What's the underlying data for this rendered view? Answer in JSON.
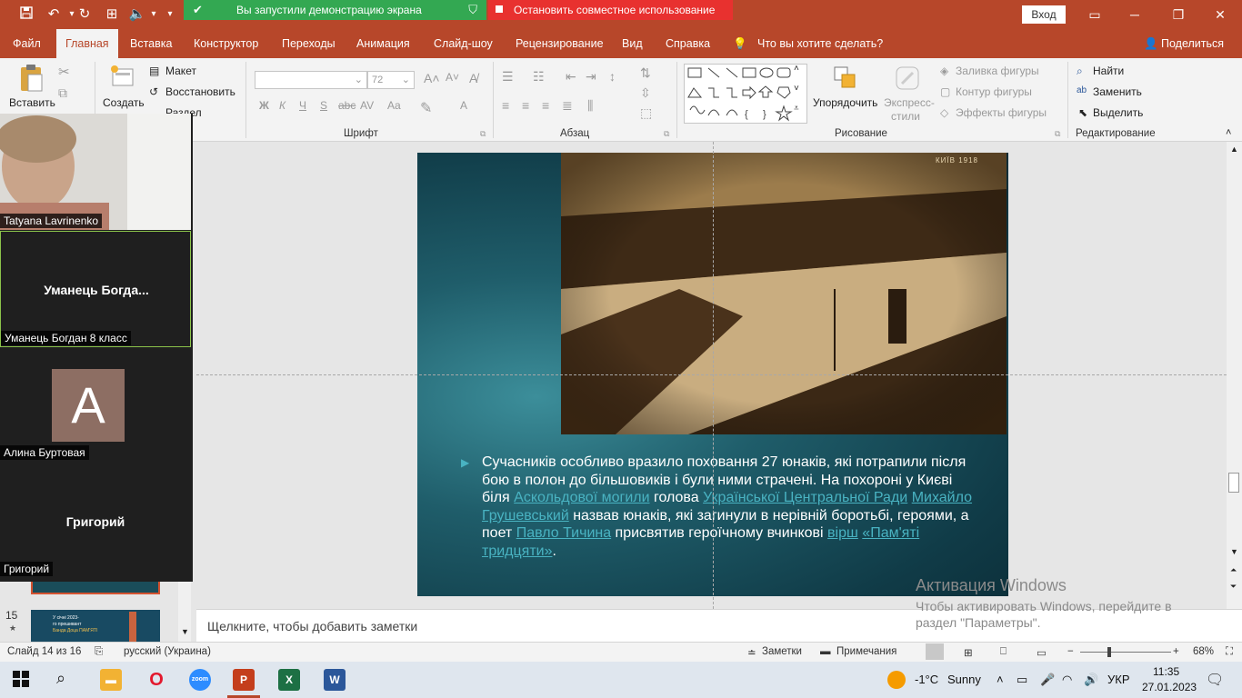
{
  "quick_access": {
    "save": "save-icon",
    "undo": "undo-icon",
    "redo": "redo-icon",
    "from_beginning": "start-slideshow-icon",
    "audio": "speaker-icon",
    "customize": "more-icon"
  },
  "zoom_share": {
    "banner_text": "Вы запустили демонстрацию экрана",
    "stop_text": "Остановить совместное использование"
  },
  "window": {
    "signin": "Вход",
    "ribbon_display": "ribbon-display-icon",
    "minimize": "minimize-icon",
    "restore": "restore-icon",
    "close": "close-icon"
  },
  "tabs": [
    "Файл",
    "Главная",
    "Вставка",
    "Конструктор",
    "Переходы",
    "Анимация",
    "Слайд-шоу",
    "Рецензирование",
    "Вид",
    "Справка"
  ],
  "active_tab": "Главная",
  "tell_me": "Что вы хотите сделать?",
  "share": "Поделиться",
  "ribbon": {
    "paste": "Вставить",
    "create": "Создать",
    "layout": "Макет",
    "reset": "Восстановить",
    "section": "Раздел",
    "font_size": "72",
    "font_group": "Шрифт",
    "bold": "Ж",
    "italic": "К",
    "underline": "Ч",
    "strike": "S",
    "shadow": "abc",
    "spacing": "AV",
    "case": "Aa",
    "font_color": "A",
    "paragraph_group": "Абзац",
    "arrange": "Упорядочить",
    "quick_styles": "Экспресс-",
    "quick_styles_2": "стили",
    "fill": "Заливка фигуры",
    "outline": "Контур фигуры",
    "effects": "Эффекты фигуры",
    "drawing_group": "Рисование",
    "find": "Найти",
    "replace": "Заменить",
    "select": "Выделить",
    "editing_group": "Редактирование"
  },
  "participants": [
    {
      "name": "Tatyana Lavrinenko",
      "type": "video"
    },
    {
      "name": "Уманець Богдан 8 класс",
      "display": "Уманець Богда...",
      "type": "name"
    },
    {
      "name": "Алина Буртовая",
      "initial": "A",
      "type": "avatar"
    },
    {
      "name": "Григорий",
      "display": "Григорий",
      "type": "name"
    }
  ],
  "thumbnails": [
    {
      "number": "15",
      "star": "★",
      "text_1": "У січні 2023-",
      "text_2": "го прешивант",
      "text_3": "Банда Доца ПАМ'ЯТІ"
    }
  ],
  "slide": {
    "photo_caption": "КИЇВ 1918",
    "text_parts": [
      {
        "t": "Сучасників особливо вразило поховання 27 юнаків, які потрапили після бою в полон до більшовиків і були ними страчені. На похороні у Києві біля ",
        "link": false
      },
      {
        "t": "Аскольдової могили",
        "link": true
      },
      {
        "t": " голова ",
        "link": false
      },
      {
        "t": "Української Центральної Ради",
        "link": true
      },
      {
        "t": " ",
        "link": false
      },
      {
        "t": "Михайло Грушевський",
        "link": true
      },
      {
        "t": " назвав юнаків, які загинули в нерівній боротьбі, героями, а поет ",
        "link": false
      },
      {
        "t": "Павло Тичина",
        "link": true
      },
      {
        "t": " присвятив героїчному вчинкові ",
        "link": false
      },
      {
        "t": "вірш",
        "link": true
      },
      {
        "t": " ",
        "link": false
      },
      {
        "t": "«Пам'яті тридцяти»",
        "link": true
      },
      {
        "t": ".",
        "link": false
      }
    ]
  },
  "notes_placeholder": "Щелкните, чтобы добавить заметки",
  "activation": {
    "title": "Активация Windows",
    "line1": "Чтобы активировать Windows, перейдите в",
    "line2": "раздел \"Параметры\"."
  },
  "status": {
    "slide": "Слайд 14 из 16",
    "language": "русский (Украина)",
    "notes": "Заметки",
    "comments": "Примечания",
    "minus": "−",
    "plus": "+",
    "zoom": "68%"
  },
  "taskbar": {
    "weather_temp": "-1°C",
    "weather_text": "Sunny",
    "lang": "УКР",
    "time": "11:35",
    "date": "27.01.2023"
  },
  "colors": {
    "powerpoint": "#b7472a",
    "zoom_green": "#33a852",
    "zoom_red": "#e8312f",
    "slide_link": "#49b3c2"
  }
}
